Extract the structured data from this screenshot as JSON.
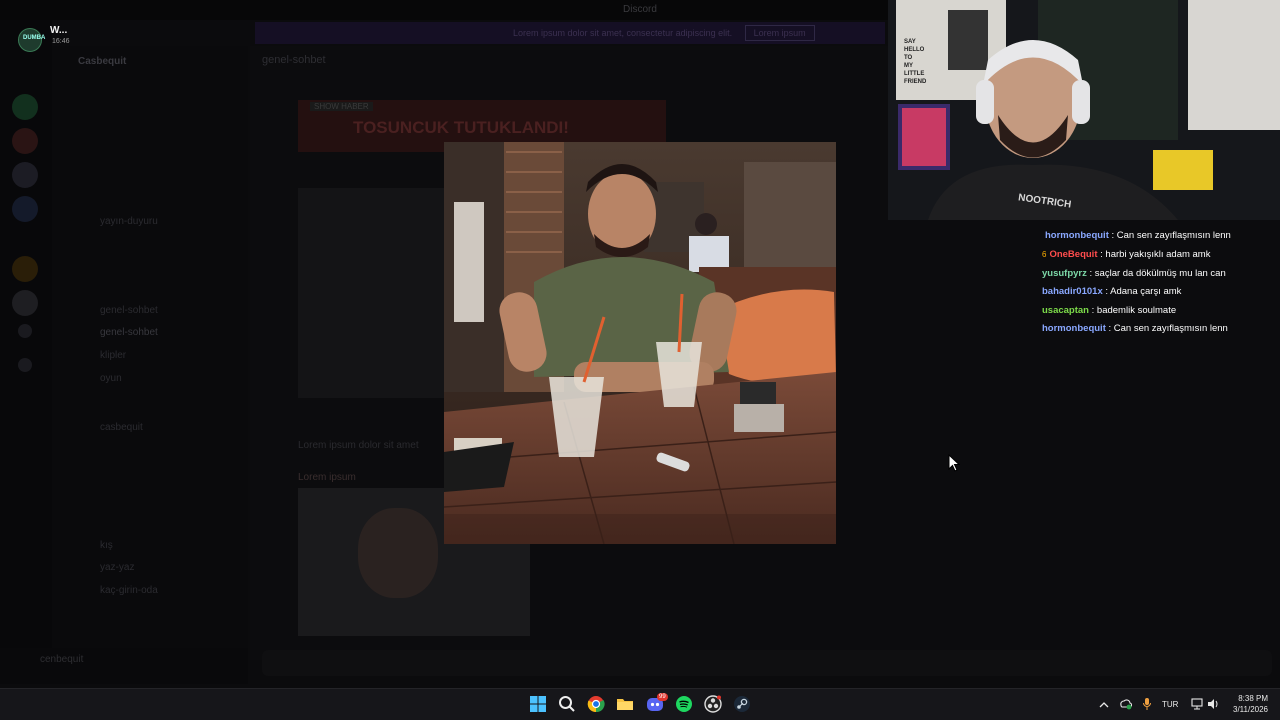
{
  "discord": {
    "window_title": "Discord",
    "banner_text": "Lorem ipsum dolor sit amet, consectetur adipiscing elit.",
    "banner_button": "Lorem ipsum",
    "server_name": "Casbequit",
    "channel_name": "genel-sohbet",
    "categories": [
      "",
      "",
      "",
      ""
    ],
    "channels": [
      "yayın-duyuru",
      "genel-sohbet",
      "genel-sohbet",
      "klipler",
      "oyun",
      "casbequit",
      "kış",
      "yaz-yaz",
      "kaç-girin-oda"
    ],
    "headline": "TOSUNCUK TUTUKLANDI!",
    "headline_tag": "SHOW HABER",
    "message_text": "Lorem ipsum dolor sit amet",
    "message_author": "Lorem ipsum",
    "user_panel_name": "cenbequit"
  },
  "notification": {
    "title": "W...",
    "time": "16:46",
    "logo_text": "DUMBA"
  },
  "chat": {
    "messages": [
      {
        "user": "hormonbequit",
        "text": "Can sen zayıflaşmısın lenn",
        "color": "#8aa8ff",
        "badge": ""
      },
      {
        "user": "OneBequit",
        "text": "harbi yakışıklı adam amk",
        "color": "#ff4d4d",
        "badge": "6"
      },
      {
        "user": "yusufpyrz",
        "text": "saçlar da dökülmüş mu lan can",
        "color": "#7dd8a8",
        "badge": ""
      },
      {
        "user": "bahadir0101x",
        "text": "Adana çarşı amk",
        "color": "#8aa8ff",
        "badge": ""
      },
      {
        "user": "usacaptan",
        "text": "bademlik soulmate",
        "color": "#7ddc4a",
        "badge": ""
      },
      {
        "user": "hormonbequit",
        "text": "Can sen zayıflaşmısın lenn",
        "color": "#8aa8ff",
        "badge": ""
      }
    ]
  },
  "webcam": {
    "shirt_text": "NOOTRICH",
    "poster_lines": [
      "SAY",
      "HELLO",
      "TO",
      "MY",
      "LITTLE",
      "FRIEND"
    ]
  },
  "taskbar": {
    "icons": [
      "windows-start-icon",
      "search-icon",
      "chrome-icon",
      "file-explorer-icon",
      "discord-icon",
      "spotify-icon",
      "obs-icon",
      "steam-icon"
    ],
    "discord_badge": "99",
    "language": "TUR",
    "time": "8:38 PM",
    "date": "3/11/2026"
  }
}
